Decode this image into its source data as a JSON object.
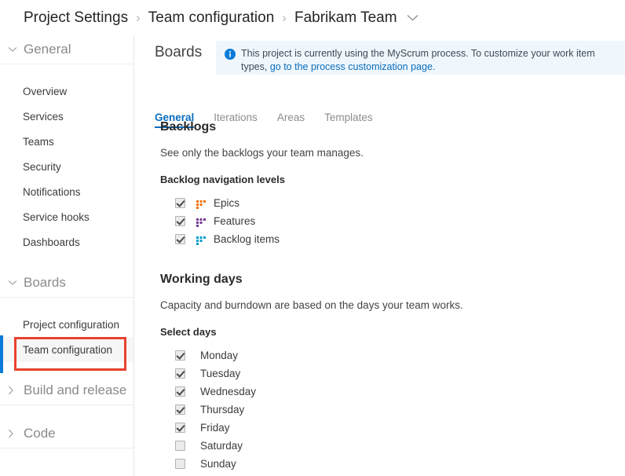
{
  "breadcrumb": {
    "items": [
      "Project Settings",
      "Team configuration",
      "Fabrikam Team"
    ],
    "separator": "›",
    "chevron_icon": "chevron-down-icon"
  },
  "sidebar": {
    "sections": [
      {
        "label": "General",
        "expanded": true,
        "chevron_icon": "chevron-down-icon",
        "items": [
          {
            "label": "Overview",
            "selected": false
          },
          {
            "label": "Services",
            "selected": false
          },
          {
            "label": "Teams",
            "selected": false
          },
          {
            "label": "Security",
            "selected": false
          },
          {
            "label": "Notifications",
            "selected": false
          },
          {
            "label": "Service hooks",
            "selected": false
          },
          {
            "label": "Dashboards",
            "selected": false
          }
        ]
      },
      {
        "label": "Boards",
        "expanded": true,
        "chevron_icon": "chevron-down-icon",
        "items": [
          {
            "label": "Project configuration",
            "selected": false
          },
          {
            "label": "Team configuration",
            "selected": true
          }
        ]
      },
      {
        "label": "Build and release",
        "expanded": false,
        "chevron_icon": "chevron-right-icon",
        "items": []
      },
      {
        "label": "Code",
        "expanded": false,
        "chevron_icon": "chevron-right-icon",
        "items": []
      }
    ],
    "highlight_color": "#e8422e",
    "accent_color": "#0a7bd8"
  },
  "main": {
    "page_title": "Boards",
    "banner": {
      "icon": "info-icon",
      "text": "This project is currently using the MyScrum process. To customize your work item types, ",
      "link_text": "go to the process customization page.",
      "background": "#eff6fc",
      "link_color": "#0a6ebd"
    },
    "tabs": [
      {
        "label": "General",
        "active": true
      },
      {
        "label": "Iterations",
        "active": false
      },
      {
        "label": "Areas",
        "active": false
      },
      {
        "label": "Templates",
        "active": false
      }
    ],
    "backlogs": {
      "heading": "Backlogs",
      "description": "See only the backlogs your team manages.",
      "sublabel": "Backlog navigation levels",
      "levels": [
        {
          "label": "Epics",
          "checked": true,
          "icon": "backlog-level-icon",
          "color": "#f2720c"
        },
        {
          "label": "Features",
          "checked": true,
          "icon": "backlog-level-icon",
          "color": "#773b93"
        },
        {
          "label": "Backlog items",
          "checked": true,
          "icon": "backlog-level-icon",
          "color": "#009ccc"
        }
      ]
    },
    "working_days": {
      "heading": "Working days",
      "description": "Capacity and burndown are based on the days your team works.",
      "sublabel": "Select days",
      "days": [
        {
          "label": "Monday",
          "checked": true
        },
        {
          "label": "Tuesday",
          "checked": true
        },
        {
          "label": "Wednesday",
          "checked": true
        },
        {
          "label": "Thursday",
          "checked": true
        },
        {
          "label": "Friday",
          "checked": true
        },
        {
          "label": "Saturday",
          "checked": false
        },
        {
          "label": "Sunday",
          "checked": false
        }
      ]
    }
  }
}
